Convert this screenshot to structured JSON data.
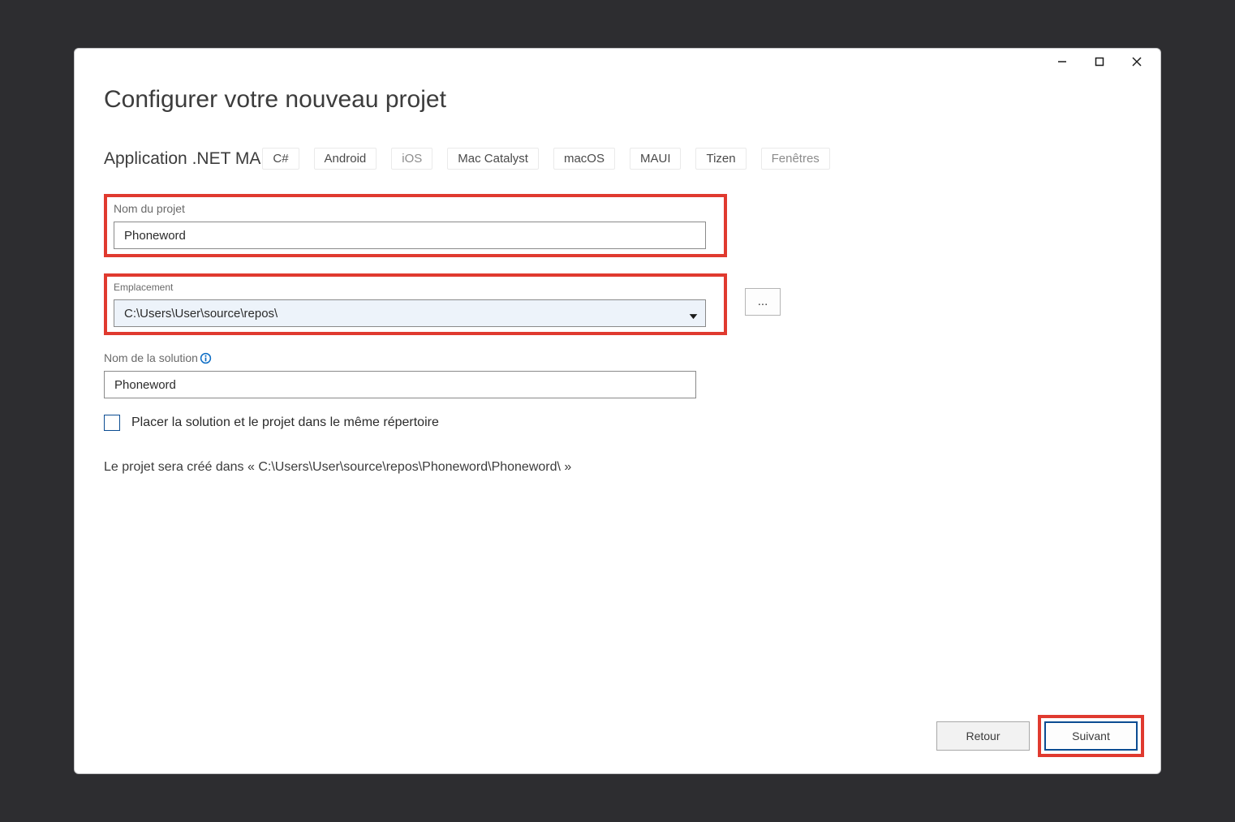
{
  "window": {
    "title": "Configurer votre nouveau projet",
    "template_name": "Application .NET MA",
    "tags": [
      "C#",
      "Android",
      "iOS",
      "Mac Catalyst",
      "macOS",
      "MAUI",
      "Tizen",
      "Fenêtres"
    ]
  },
  "fields": {
    "project_name": {
      "label": "Nom du projet",
      "value": "Phoneword"
    },
    "location": {
      "label": "Emplacement",
      "value": "C:\\Users\\User\\source\\repos\\",
      "browse": "..."
    },
    "solution_name": {
      "label": "Nom de la solution",
      "value": "Phoneword"
    }
  },
  "checkbox": {
    "label": "Placer la solution et le projet dans le même répertoire",
    "checked": false
  },
  "info_text": "Le projet sera créé dans « C:\\Users\\User\\source\\repos\\Phoneword\\Phoneword\\ »",
  "buttons": {
    "back": "Retour",
    "next": "Suivant"
  }
}
